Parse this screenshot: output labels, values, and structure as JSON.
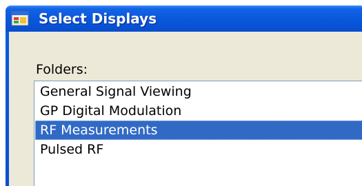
{
  "window": {
    "title": "Select Displays"
  },
  "folders": {
    "label": "Folders:",
    "items": [
      {
        "label": "General Signal Viewing",
        "selected": false
      },
      {
        "label": "GP Digital Modulation",
        "selected": false
      },
      {
        "label": "RF Measurements",
        "selected": true
      },
      {
        "label": "Pulsed RF",
        "selected": false
      }
    ]
  },
  "colors": {
    "titlebar": "#0a58dc",
    "client": "#ece9d8",
    "selection": "#316ac5",
    "list_border": "#7f9db9"
  },
  "icons": {
    "app_icon": "application-window-icon"
  }
}
